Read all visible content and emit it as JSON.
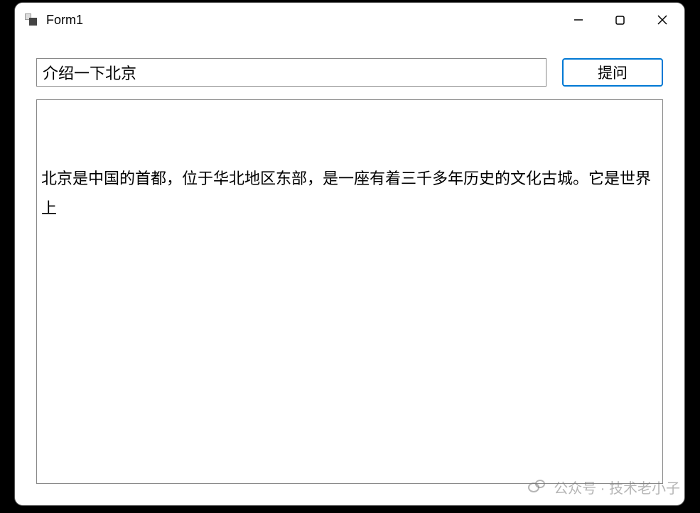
{
  "window": {
    "title": "Form1"
  },
  "input": {
    "value": "介绍一下北京"
  },
  "button": {
    "label": "提问"
  },
  "output": {
    "text": "北京是中国的首都，位于华北地区东部，是一座有着三千多年历史的文化古城。它是世界上"
  },
  "watermark": {
    "text": "公众号 · 技术老小子"
  }
}
